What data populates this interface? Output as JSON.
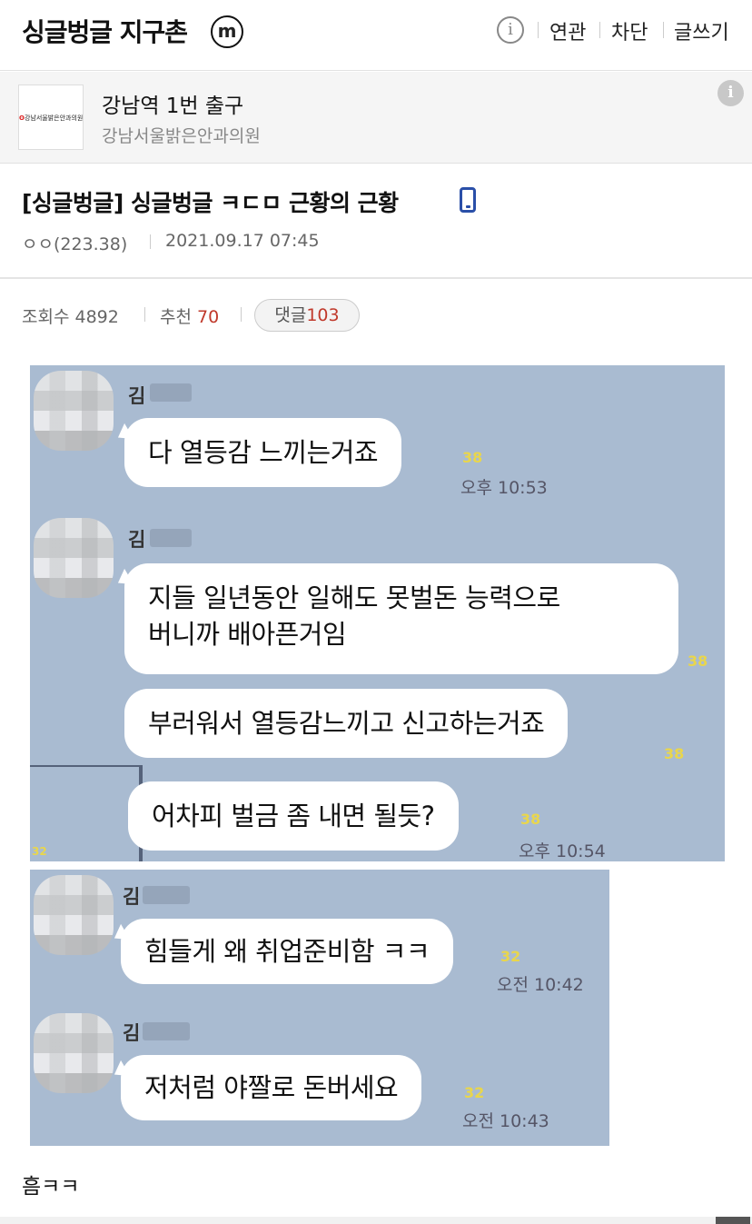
{
  "header": {
    "gallery_title": "싱글벙글 지구촌",
    "badge": "m",
    "info_icon": "i",
    "nav": [
      "연관",
      "차단",
      "글쓰기"
    ]
  },
  "ad": {
    "logo_text": "강남서울밝은안과의원",
    "title": "강남역 1번 출구",
    "subtitle": "강남서울밝은안과의원",
    "info_icon": "i"
  },
  "post": {
    "title": "[싱글벙글] 싱글벙글 ㅋㄷㅁ 근황의 근황",
    "author": "ㅇㅇ(223.38)",
    "date": "2021.09.17 07:45",
    "views_label": "조회수 4892",
    "recommend_label": "추천",
    "recommend_count": "70",
    "comments_label": "댓글",
    "comments_count": "103"
  },
  "chat1": {
    "messages": [
      {
        "sender": "김",
        "text": "다 열등감 느끼는거죠",
        "unread": "38",
        "time": "오후 10:53"
      },
      {
        "sender": "김",
        "text1": "지들 일년동안 일해도 못벌돈 능력으로",
        "text2": "버니까 배아픈거임",
        "unread": "38"
      },
      {
        "text": "부러워서 열등감느끼고 신고하는거죠",
        "unread": "38"
      },
      {
        "text": "어차피 벌금 좀 내면 될듯?",
        "unread": "38",
        "time": "오후 10:54"
      }
    ],
    "corner_unread": "32"
  },
  "chat2": {
    "messages": [
      {
        "sender": "김",
        "text": "힘들게 왜 취업준비함 ㅋㅋ",
        "unread": "32",
        "time": "오전 10:42"
      },
      {
        "sender": "김",
        "text": "저처럼 야짤로 돈버세요",
        "unread": "32",
        "time": "오전 10:43"
      }
    ]
  },
  "body_text": "흠ㅋㅋ"
}
